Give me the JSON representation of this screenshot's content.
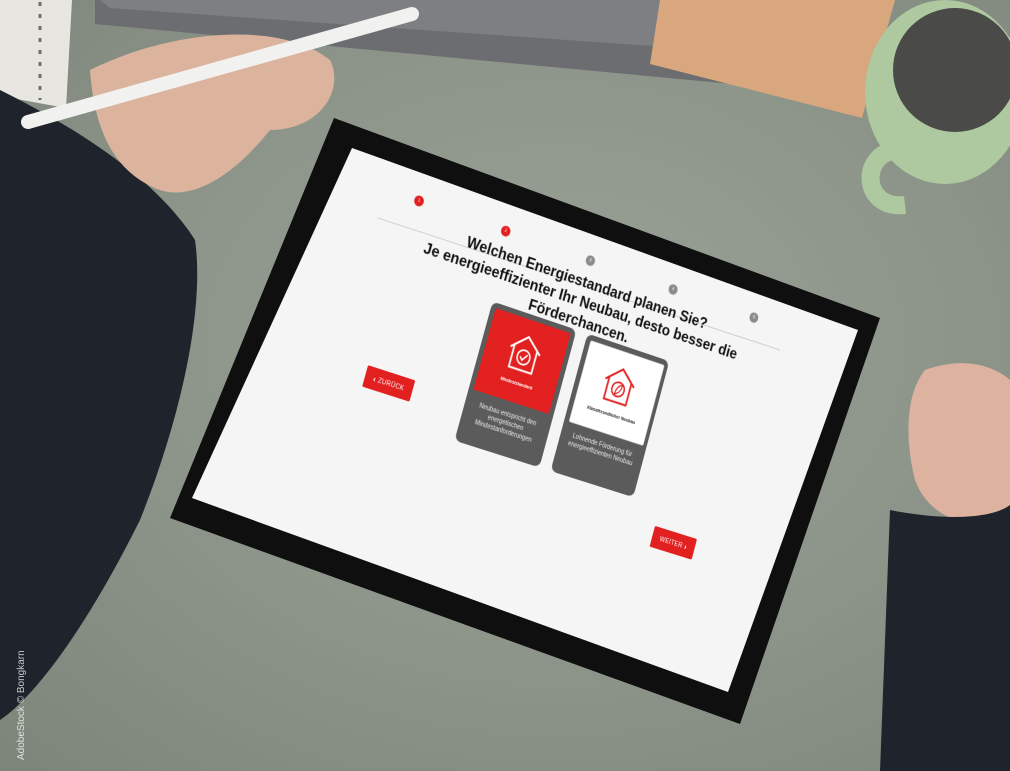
{
  "progress": {
    "steps": [
      {
        "label": "1",
        "state": "active"
      },
      {
        "label": "2",
        "state": "active"
      },
      {
        "label": "3",
        "state": "todo"
      },
      {
        "label": "4",
        "state": "todo"
      },
      {
        "label": "5",
        "state": "todo"
      }
    ]
  },
  "heading": {
    "line1": "Welchen Energiestandard planen Sie?",
    "line2": "Je energieeffizienter Ihr Neubau, desto besser die Förderchancen."
  },
  "options": [
    {
      "title": "Mindeststandard",
      "description": "Neubau entspricht den energetischen Mindestanforderungen",
      "icon": "house-check-icon",
      "selected": true
    },
    {
      "title": "Klimafreundlicher Neubau",
      "description": "Lohnende Förderung für energieeffizienten Neubau",
      "icon": "house-leaf-icon",
      "selected": false
    }
  ],
  "nav": {
    "back_label": "ZURÜCK",
    "back_icon": "chevron-left-icon",
    "next_label": "WEITER",
    "next_icon": "chevron-right-icon"
  },
  "credit": "AdobeStock © Bongkarn",
  "colors": {
    "accent": "#e1201f",
    "card": "#5b5b5c",
    "inactive_step": "#8b8b8b",
    "screen": "#f5f5f5",
    "desk": "#8f978c"
  }
}
